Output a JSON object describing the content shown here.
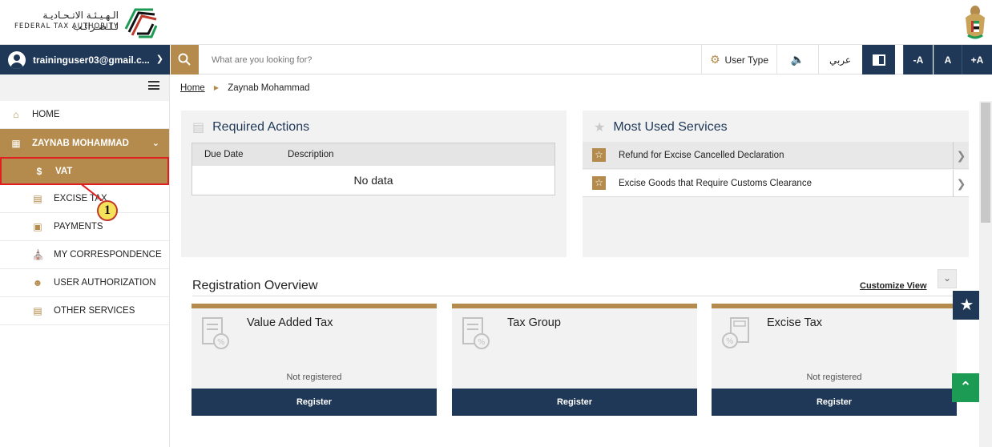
{
  "header": {
    "logo_ar": "الـهـيـئـة الاتـحـاديـة لـلـضـرائـب",
    "logo_en": "FEDERAL TAX AUTHORITY"
  },
  "navbar": {
    "user_email": "traininguser03@gmail.c...",
    "search_placeholder": "What are you looking for?",
    "user_type": "User Type",
    "arabic": "عربي",
    "font_minus": "-A",
    "font_normal": "A",
    "font_plus": "+A"
  },
  "sidebar": {
    "items": [
      {
        "label": "HOME"
      },
      {
        "label": "ZAYNAB MOHAMMAD"
      },
      {
        "label": "VAT"
      },
      {
        "label": "EXCISE TAX"
      },
      {
        "label": "PAYMENTS"
      },
      {
        "label": "MY CORRESPONDENCE"
      },
      {
        "label": "USER AUTHORIZATION"
      },
      {
        "label": "OTHER SERVICES"
      }
    ],
    "annotation": "1"
  },
  "breadcrumb": {
    "home": "Home",
    "current": "Zaynab Mohammad"
  },
  "required_actions": {
    "title": "Required Actions",
    "columns": [
      "Due Date",
      "Description"
    ],
    "empty": "No data"
  },
  "most_used": {
    "title": "Most Used Services",
    "items": [
      "Refund for Excise Cancelled Declaration",
      "Excise Goods that Require Customs Clearance"
    ]
  },
  "registration": {
    "title": "Registration Overview",
    "customize": "Customize View",
    "cards": [
      {
        "title": "Value Added Tax",
        "status": "Not registered",
        "button": "Register"
      },
      {
        "title": "Tax Group",
        "status": "",
        "button": "Register"
      },
      {
        "title": "Excise Tax",
        "status": "Not registered",
        "button": "Register"
      }
    ]
  },
  "colors": {
    "navy": "#1f3857",
    "gold": "#b48b4c",
    "green": "#1c9b55",
    "annotation_red": "#e02020"
  }
}
